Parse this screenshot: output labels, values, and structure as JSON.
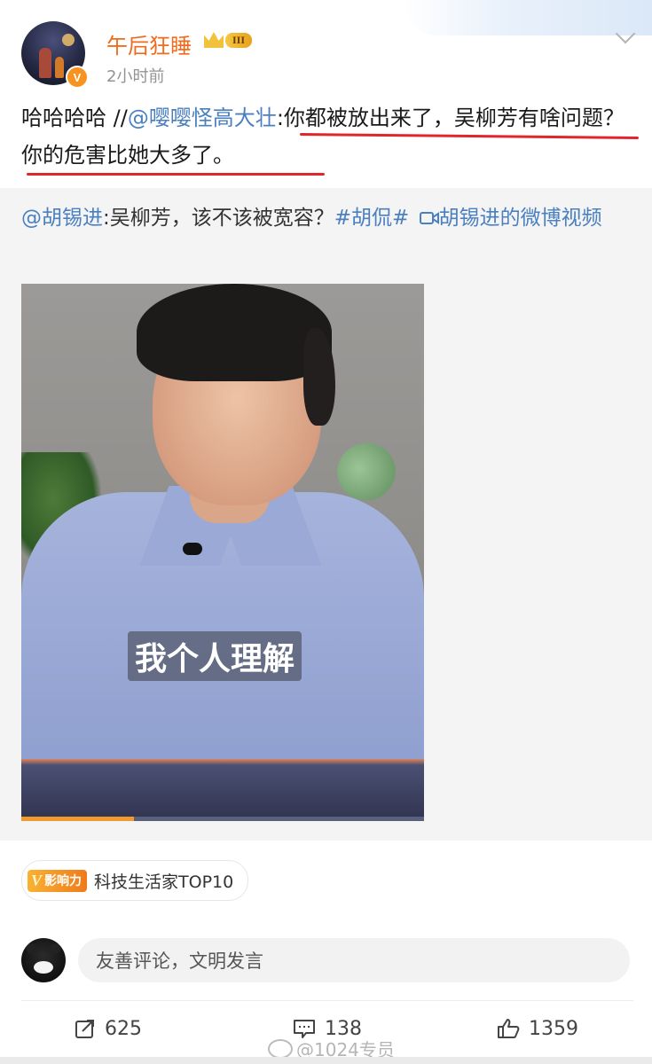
{
  "author": {
    "name": "午后狂睡",
    "verified_badge": "V",
    "level_badge": "III",
    "timestamp": "2小时前"
  },
  "post": {
    "prefix": "哈哈哈哈 //",
    "mention": "@嘤嘤怪高大壮",
    "body": ":你都被放出来了，吴柳芳有啥问题？你的危害比她大多了。"
  },
  "repost": {
    "mention": "@胡锡进",
    "text": ":吴柳芳，该不该被宽容？",
    "hashtag": "#胡侃#",
    "video_link": "胡锡进的微博视频",
    "video": {
      "subtitle": "我个人理解",
      "progress": 0.28
    }
  },
  "influence": {
    "logo_v": "V",
    "logo_text": "影响力",
    "label": "科技生活家TOP10"
  },
  "comment": {
    "placeholder": "友善评论，文明发言"
  },
  "actions": {
    "repost_count": "625",
    "comment_count": "138",
    "like_count": "1359"
  },
  "watermark": "@1024专员",
  "colors": {
    "username": "#f26b1d",
    "link": "#4a7fc0",
    "underline": "#e0262b",
    "progress": "#f39a2c"
  },
  "icons": {
    "more": "chevron-down-icon",
    "repost": "share-icon",
    "comment": "comment-icon",
    "like": "thumbs-up-icon"
  }
}
